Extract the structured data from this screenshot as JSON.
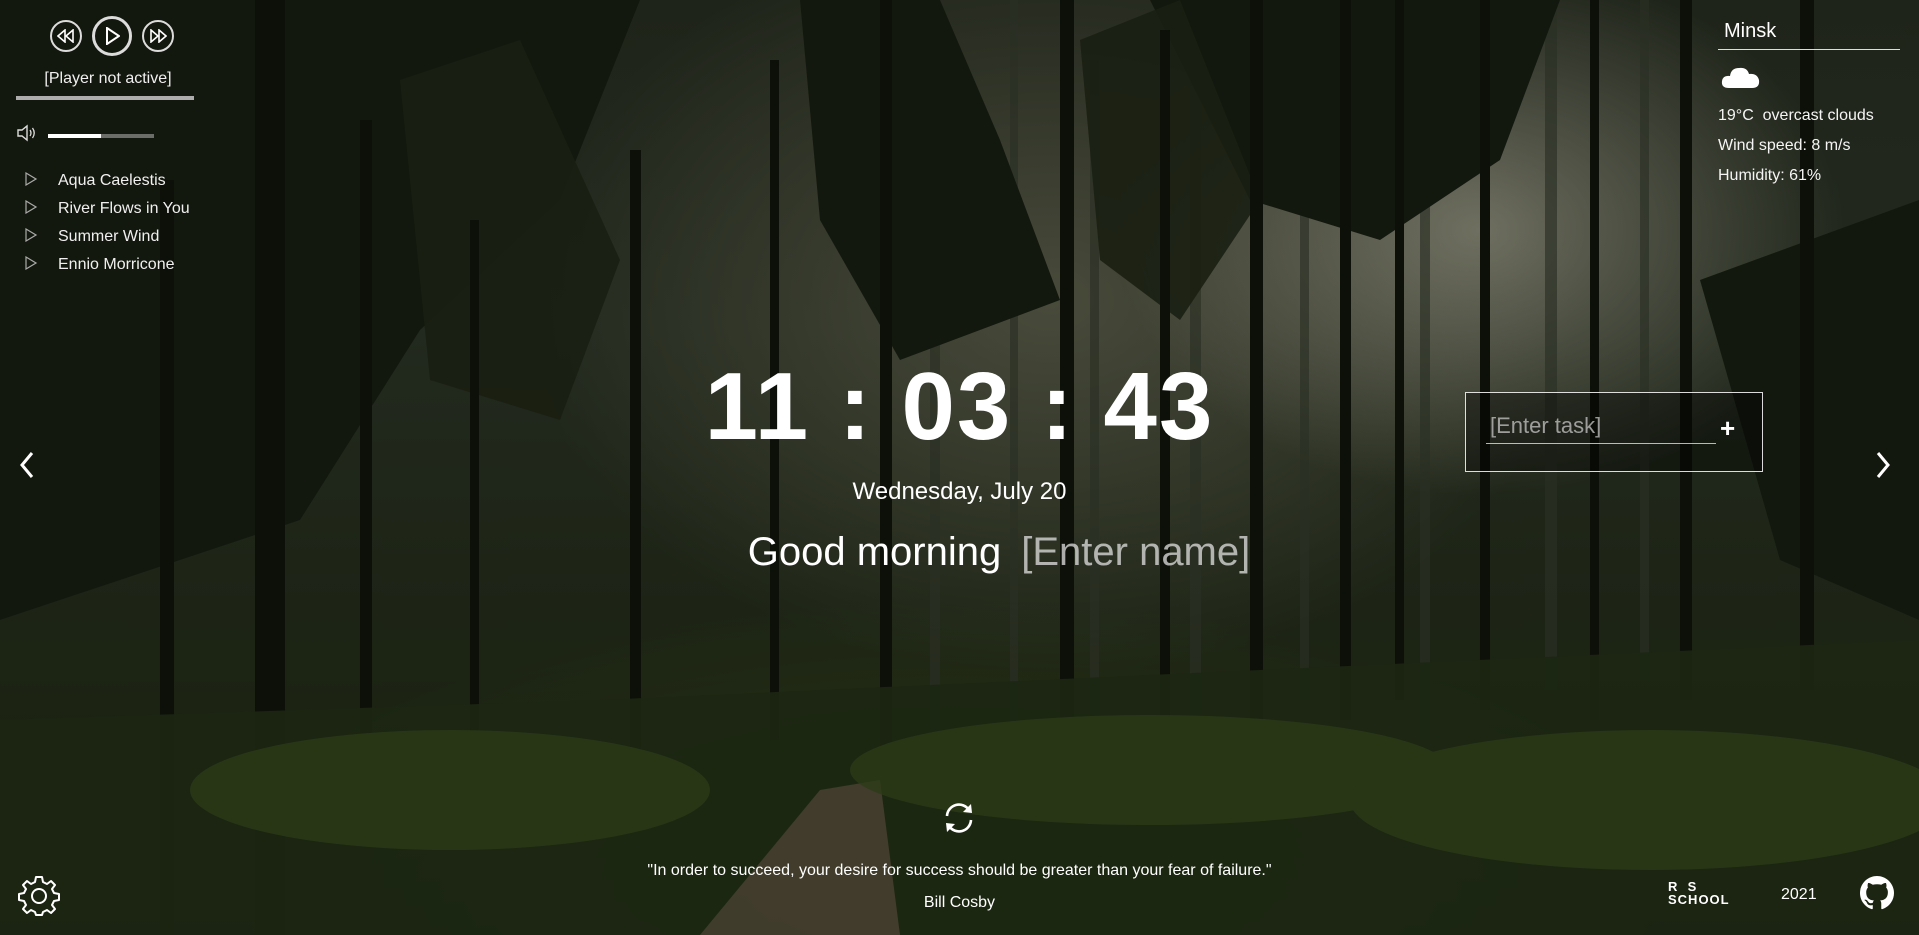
{
  "player": {
    "status": "[Player not active]",
    "progress": 0,
    "volume": 0.5,
    "controls": [
      "play-prev-icon",
      "play-icon",
      "play-next-icon"
    ],
    "playlist": [
      {
        "title": "Aqua Caelestis"
      },
      {
        "title": "River Flows in You"
      },
      {
        "title": "Summer Wind"
      },
      {
        "title": "Ennio Morricone"
      }
    ]
  },
  "weather": {
    "city": "Minsk",
    "icon": "cloud-icon",
    "temperature": "19°C",
    "description": "overcast clouds",
    "wind": "Wind speed: 8 m/s",
    "humidity": "Humidity: 61%"
  },
  "clock": {
    "time": "11 : 03 : 43",
    "date": "Wednesday, July 20"
  },
  "greeting": {
    "text": "Good morning",
    "name_placeholder": "[Enter name]"
  },
  "todo": {
    "placeholder": "[Enter task]",
    "add_label": "+"
  },
  "quote": {
    "text": "\"In order to succeed, your desire for success should be greater than your fear of failure.\"",
    "author": "Bill Cosby"
  },
  "footer": {
    "logo_line1": "R  S",
    "logo_line2": "SCHOOL",
    "year": "2021"
  },
  "icons": {
    "prev": "slide-prev-icon",
    "next": "slide-next-icon",
    "refresh": "refresh-icon",
    "settings": "gear-icon",
    "github": "github-icon"
  }
}
